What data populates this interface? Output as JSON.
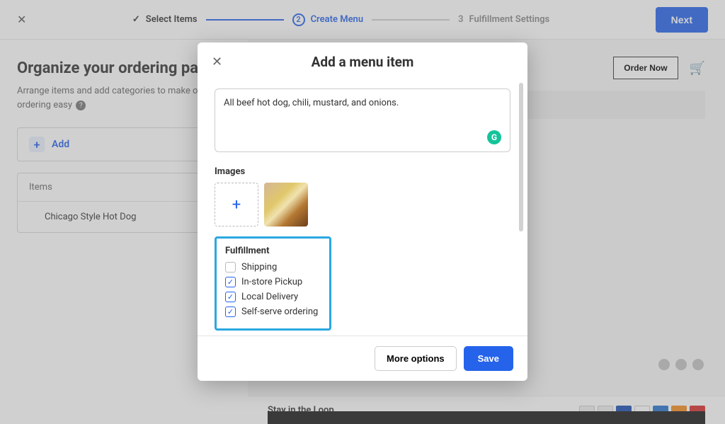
{
  "topbar": {
    "step1_label": "Select Items",
    "step2_num": "2",
    "step2_label": "Create Menu",
    "step3_num": "3",
    "step3_label": "Fulfillment Settings",
    "next_label": "Next"
  },
  "left": {
    "title": "Organize your ordering page",
    "subtitle_a": "Arrange items and add categories to make online",
    "subtitle_b": "ordering easy",
    "add_label": "Add",
    "items_header": "Items",
    "item1": "Chicago Style Hot Dog"
  },
  "preview": {
    "order_now": "Order Now",
    "stay_in_loop": "Stay in the Loop"
  },
  "modal": {
    "title": "Add a menu item",
    "description_value": "All beef hot dog, chili, mustard, and onions.",
    "images_label": "Images",
    "fulfillment_label": "Fulfillment",
    "chk_shipping": "Shipping",
    "chk_pickup": "In-store Pickup",
    "chk_local": "Local Delivery",
    "chk_self": "Self-serve ordering",
    "more_options": "More options",
    "save": "Save"
  }
}
